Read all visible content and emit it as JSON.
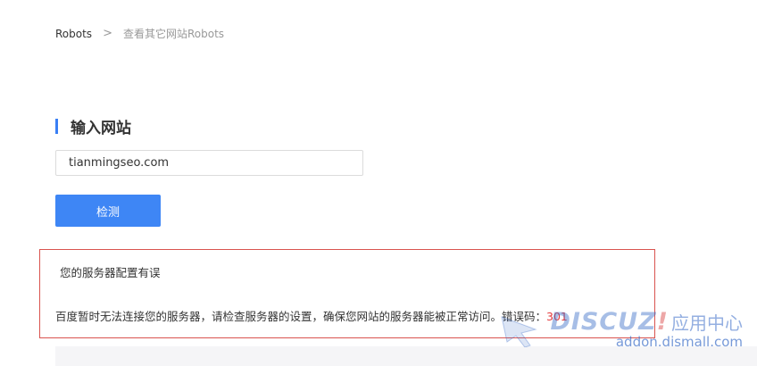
{
  "breadcrumb": {
    "root": "Robots",
    "separator": ">",
    "current": "查看其它网站Robots"
  },
  "section": {
    "title": "输入网站"
  },
  "form": {
    "site_value": "tianmingseo.com",
    "check_label": "检测"
  },
  "result": {
    "title": "您的服务器配置有误",
    "message": "百度暂时无法连接您的服务器，请检查服务器的设置，确保您网站的服务器能被正常访问。错误码：",
    "code": "301"
  },
  "watermark": {
    "logo": "DISCUZ",
    "exclaim": "!",
    "center": "应用中心",
    "domain": "addon.dismall.com"
  },
  "colors": {
    "accent": "#3e86f5",
    "error_border": "#d9534f",
    "error_code": "#e4393c"
  }
}
